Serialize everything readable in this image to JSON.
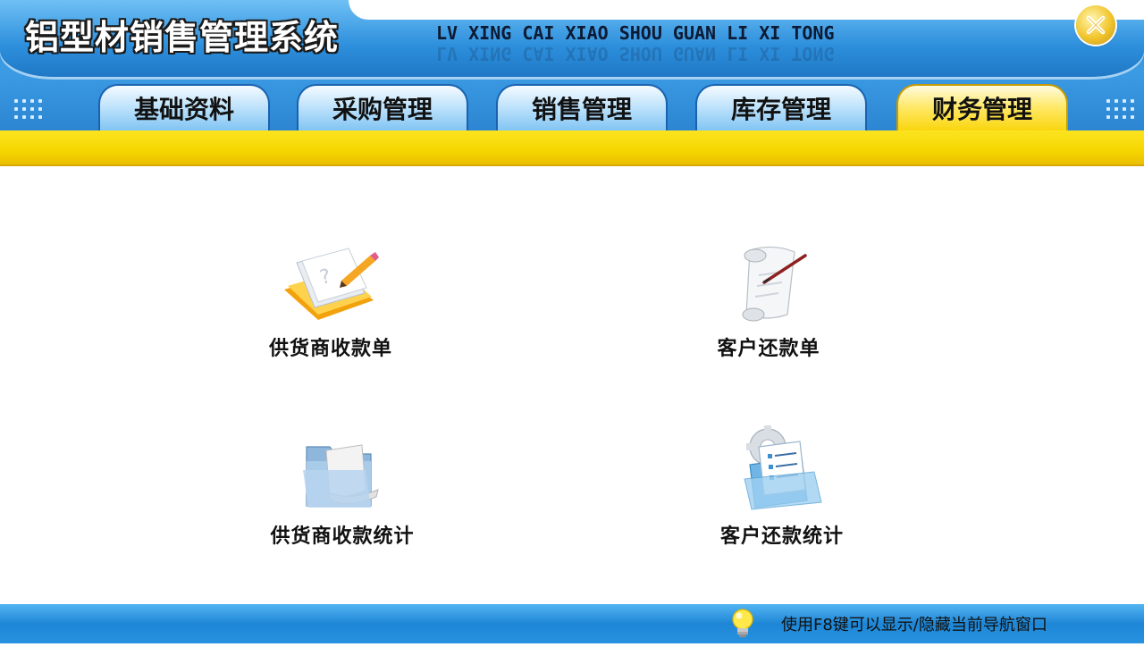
{
  "header": {
    "title": "铝型材销售管理系统",
    "pinyin": "LV XING CAI XIAO SHOU GUAN LI XI TONG",
    "close_icon": "close-icon"
  },
  "tabs": [
    {
      "label": "基础资料",
      "active": false
    },
    {
      "label": "采购管理",
      "active": false
    },
    {
      "label": "销售管理",
      "active": false
    },
    {
      "label": "库存管理",
      "active": false
    },
    {
      "label": "财务管理",
      "active": true
    }
  ],
  "tiles": [
    {
      "label": "供货商收款单",
      "icon": "notebook-pencil-icon"
    },
    {
      "label": "客户还款单",
      "icon": "scroll-pen-icon"
    },
    {
      "label": "供货商收款统计",
      "icon": "folder-document-icon"
    },
    {
      "label": "客户还款统计",
      "icon": "report-gear-icon"
    }
  ],
  "footer": {
    "hint": "使用F8键可以显示/隐藏当前导航窗口",
    "icon": "lightbulb-icon"
  },
  "colors": {
    "header_blue": "#2f8ed8",
    "active_tab_yellow": "#f9d300",
    "band_yellow": "#f6d600",
    "footer_blue": "#1e86d6"
  }
}
